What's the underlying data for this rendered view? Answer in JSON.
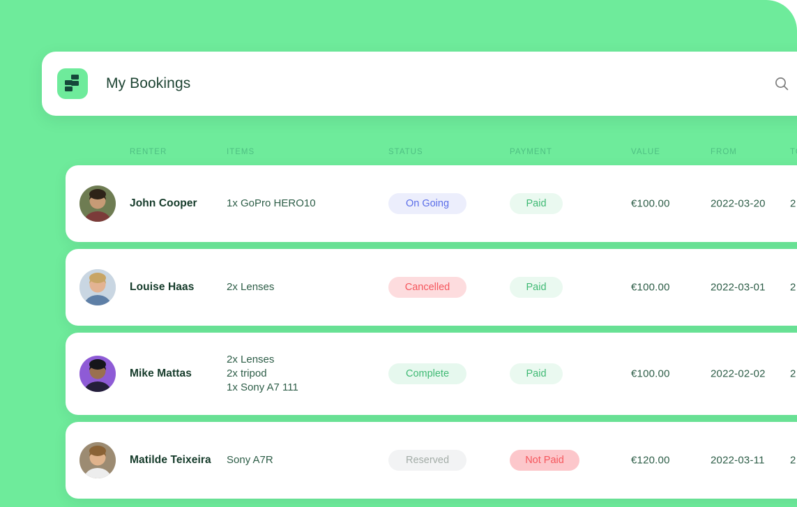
{
  "brand": {
    "logo_icon": "step-blocks-logo-icon",
    "logo_bg": "#6EEB9B",
    "logo_fg": "#15483A"
  },
  "header": {
    "title": "My Bookings",
    "search_icon": "search-icon"
  },
  "theme": {
    "page_bg": "#6EEB9B",
    "card_bg": "#FFFFFF",
    "header_label_color": "#4FBF83",
    "text_color": "#2D5D47",
    "name_color": "#143A29"
  },
  "table": {
    "columns": [
      {
        "key": "renter",
        "label": "RENTER"
      },
      {
        "key": "items",
        "label": "ITEMS"
      },
      {
        "key": "status",
        "label": "STATUS"
      },
      {
        "key": "payment",
        "label": "PAYMENT"
      },
      {
        "key": "value",
        "label": "VALUE"
      },
      {
        "key": "from",
        "label": "FROM"
      },
      {
        "key": "to",
        "label": "TO"
      }
    ],
    "rows": [
      {
        "renter": "John Cooper",
        "avatar": "avatar-john-cooper",
        "items": "1x GoPro HERO10",
        "status": "On Going",
        "status_variant": "ongoing",
        "payment": "Paid",
        "payment_variant": "paid",
        "value": "€100.00",
        "from": "2022-03-20",
        "to": "2"
      },
      {
        "renter": "Louise Haas",
        "avatar": "avatar-louise-haas",
        "items": "2x Lenses",
        "status": "Cancelled",
        "status_variant": "cancelled",
        "payment": "Paid",
        "payment_variant": "paid",
        "value": "€100.00",
        "from": "2022-03-01",
        "to": "2"
      },
      {
        "renter": "Mike Mattas",
        "avatar": "avatar-mike-mattas",
        "items": "2x Lenses\n2x tripod\n1x Sony A7 111",
        "status": "Complete",
        "status_variant": "complete",
        "payment": "Paid",
        "payment_variant": "paid",
        "value": "€100.00",
        "from": "2022-02-02",
        "to": "2"
      },
      {
        "renter": "Matilde Teixeira",
        "avatar": "avatar-matilde-teixeira",
        "items": "Sony A7R",
        "status": "Reserved",
        "status_variant": "reserved",
        "payment": "Not Paid",
        "payment_variant": "notpaid",
        "value": "€120.00",
        "from": "2022-03-11",
        "to": "2"
      }
    ]
  }
}
